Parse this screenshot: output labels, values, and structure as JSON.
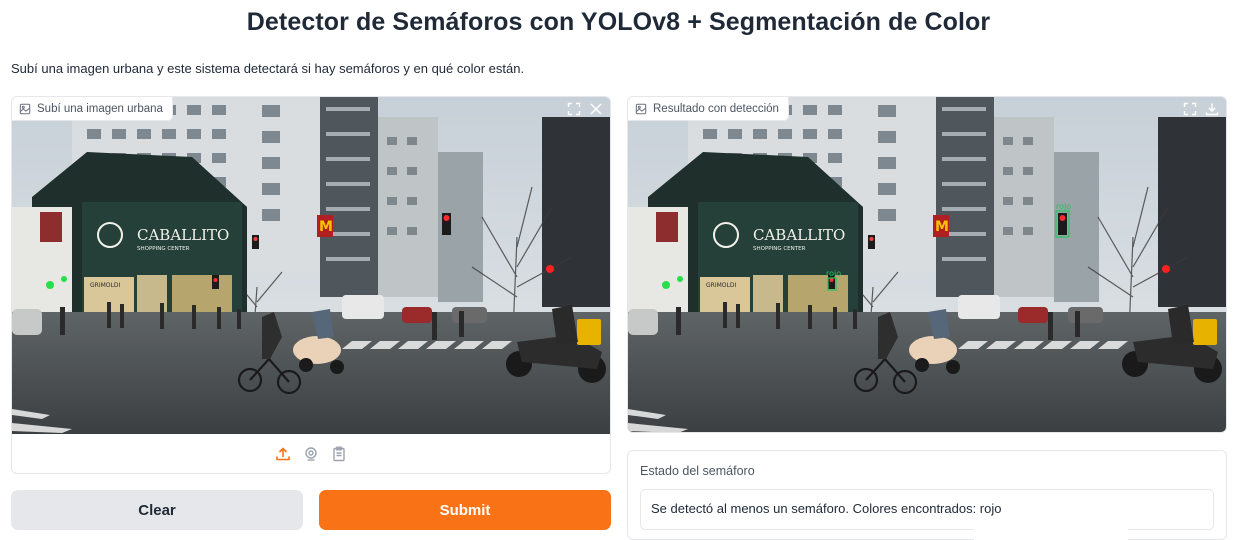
{
  "header": {
    "title": "Detector de Semáforos con YOLOv8 + Segmentación de Color",
    "description": "Subí una imagen urbana y este sistema detectará si hay semáforos y en qué color están."
  },
  "input_panel": {
    "label": "Subí una imagen urbana",
    "label_icon": "image-icon",
    "corner_icons": [
      "fullscreen-icon",
      "close-icon"
    ],
    "source_icons": [
      "upload-icon",
      "webcam-icon",
      "clipboard-icon"
    ]
  },
  "output_panel": {
    "label": "Resultado con detección",
    "label_icon": "image-icon",
    "corner_icons": [
      "fullscreen-icon",
      "download-icon"
    ],
    "detections": [
      {
        "label": "rojo"
      },
      {
        "label": "rojo"
      }
    ]
  },
  "buttons": {
    "clear": "Clear",
    "submit": "Submit"
  },
  "status": {
    "label": "Estado del semáforo",
    "value": "Se detectó al menos un semáforo. Colores encontrados: rojo"
  },
  "colors": {
    "accent": "#f97316",
    "detection_box": "#22c55e",
    "border": "#e5e7eb"
  }
}
